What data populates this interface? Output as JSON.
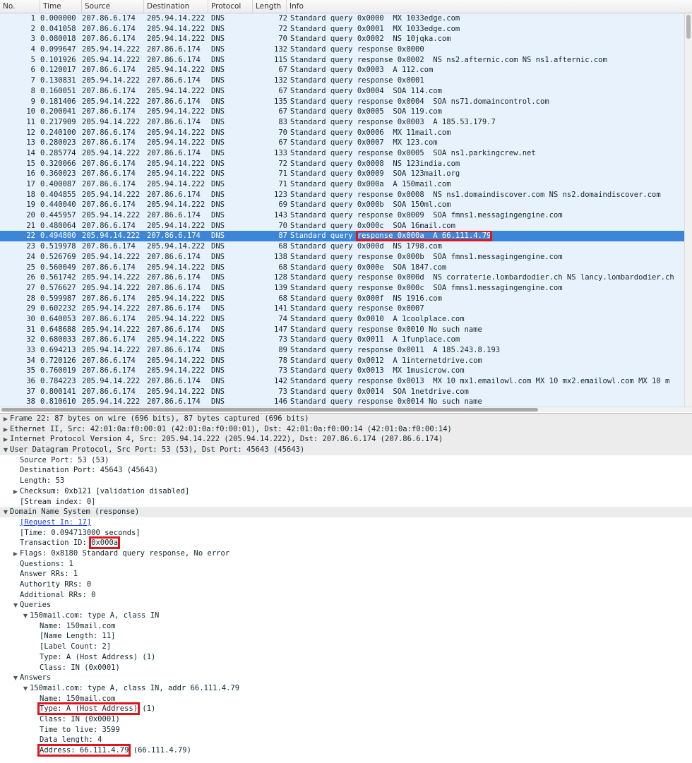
{
  "columns": [
    "No.",
    "Time",
    "Source",
    "Destination",
    "Protocol",
    "Length",
    "Info"
  ],
  "packets": [
    {
      "no": "1",
      "time": "0.000000",
      "src": "207.86.6.174",
      "dst": "205.94.14.222",
      "proto": "DNS",
      "len": "72",
      "info": "Standard query 0x0000  MX 1033edge.com"
    },
    {
      "no": "2",
      "time": "0.041058",
      "src": "207.86.6.174",
      "dst": "205.94.14.222",
      "proto": "DNS",
      "len": "72",
      "info": "Standard query 0x0001  MX 1033edge.com"
    },
    {
      "no": "3",
      "time": "0.080018",
      "src": "207.86.6.174",
      "dst": "205.94.14.222",
      "proto": "DNS",
      "len": "70",
      "info": "Standard query 0x0002  NS 10jqka.com"
    },
    {
      "no": "4",
      "time": "0.099647",
      "src": "205.94.14.222",
      "dst": "207.86.6.174",
      "proto": "DNS",
      "len": "132",
      "info": "Standard query response 0x0000"
    },
    {
      "no": "5",
      "time": "0.101926",
      "src": "205.94.14.222",
      "dst": "207.86.6.174",
      "proto": "DNS",
      "len": "115",
      "info": "Standard query response 0x0002  NS ns2.afternic.com NS ns1.afternic.com"
    },
    {
      "no": "6",
      "time": "0.120017",
      "src": "207.86.6.174",
      "dst": "205.94.14.222",
      "proto": "DNS",
      "len": "67",
      "info": "Standard query 0x0003  A 112.com"
    },
    {
      "no": "7",
      "time": "0.130831",
      "src": "205.94.14.222",
      "dst": "207.86.6.174",
      "proto": "DNS",
      "len": "132",
      "info": "Standard query response 0x0001"
    },
    {
      "no": "8",
      "time": "0.160051",
      "src": "207.86.6.174",
      "dst": "205.94.14.222",
      "proto": "DNS",
      "len": "67",
      "info": "Standard query 0x0004  SOA 114.com"
    },
    {
      "no": "9",
      "time": "0.181406",
      "src": "205.94.14.222",
      "dst": "207.86.6.174",
      "proto": "DNS",
      "len": "135",
      "info": "Standard query response 0x0004  SOA ns71.domaincontrol.com"
    },
    {
      "no": "10",
      "time": "0.200041",
      "src": "207.86.6.174",
      "dst": "205.94.14.222",
      "proto": "DNS",
      "len": "67",
      "info": "Standard query 0x0005  SOA 119.com"
    },
    {
      "no": "11",
      "time": "0.217909",
      "src": "205.94.14.222",
      "dst": "207.86.6.174",
      "proto": "DNS",
      "len": "83",
      "info": "Standard query response 0x0003  A 185.53.179.7"
    },
    {
      "no": "12",
      "time": "0.240100",
      "src": "207.86.6.174",
      "dst": "205.94.14.222",
      "proto": "DNS",
      "len": "70",
      "info": "Standard query 0x0006  MX 11mail.com"
    },
    {
      "no": "13",
      "time": "0.280023",
      "src": "207.86.6.174",
      "dst": "205.94.14.222",
      "proto": "DNS",
      "len": "67",
      "info": "Standard query 0x0007  MX 123.com"
    },
    {
      "no": "14",
      "time": "0.285774",
      "src": "205.94.14.222",
      "dst": "207.86.6.174",
      "proto": "DNS",
      "len": "133",
      "info": "Standard query response 0x0005  SOA ns1.parkingcrew.net"
    },
    {
      "no": "15",
      "time": "0.320066",
      "src": "207.86.6.174",
      "dst": "205.94.14.222",
      "proto": "DNS",
      "len": "72",
      "info": "Standard query 0x0008  NS 123india.com"
    },
    {
      "no": "16",
      "time": "0.360023",
      "src": "207.86.6.174",
      "dst": "205.94.14.222",
      "proto": "DNS",
      "len": "71",
      "info": "Standard query 0x0009  SOA 123mail.org"
    },
    {
      "no": "17",
      "time": "0.400087",
      "src": "207.86.6.174",
      "dst": "205.94.14.222",
      "proto": "DNS",
      "len": "71",
      "info": "Standard query 0x000a  A 150mail.com"
    },
    {
      "no": "18",
      "time": "0.404855",
      "src": "205.94.14.222",
      "dst": "207.86.6.174",
      "proto": "DNS",
      "len": "123",
      "info": "Standard query response 0x0008  NS ns1.domaindiscover.com NS ns2.domaindiscover.com"
    },
    {
      "no": "19",
      "time": "0.440040",
      "src": "207.86.6.174",
      "dst": "205.94.14.222",
      "proto": "DNS",
      "len": "69",
      "info": "Standard query 0x000b  SOA 150ml.com"
    },
    {
      "no": "20",
      "time": "0.445957",
      "src": "205.94.14.222",
      "dst": "207.86.6.174",
      "proto": "DNS",
      "len": "143",
      "info": "Standard query response 0x0009  SOA fmns1.messagingengine.com"
    },
    {
      "no": "21",
      "time": "0.480064",
      "src": "207.86.6.174",
      "dst": "205.94.14.222",
      "proto": "DNS",
      "len": "70",
      "info": "Standard query 0x000c  SOA 16mail.com"
    },
    {
      "no": "22",
      "time": "0.494800",
      "src": "205.94.14.222",
      "dst": "207.86.6.174",
      "proto": "DNS",
      "len": "87",
      "info_pre": "Standard query ",
      "info_hl": "response 0x000a  A 66.111.4.79",
      "selected": true
    },
    {
      "no": "23",
      "time": "0.519978",
      "src": "207.86.6.174",
      "dst": "205.94.14.222",
      "proto": "DNS",
      "len": "68",
      "info": "Standard query 0x000d  NS 1798.com"
    },
    {
      "no": "24",
      "time": "0.526769",
      "src": "205.94.14.222",
      "dst": "207.86.6.174",
      "proto": "DNS",
      "len": "138",
      "info": "Standard query response 0x000b  SOA fmns1.messagingengine.com"
    },
    {
      "no": "25",
      "time": "0.560049",
      "src": "207.86.6.174",
      "dst": "205.94.14.222",
      "proto": "DNS",
      "len": "68",
      "info": "Standard query 0x000e  SOA 1847.com"
    },
    {
      "no": "26",
      "time": "0.561742",
      "src": "205.94.14.222",
      "dst": "207.86.6.174",
      "proto": "DNS",
      "len": "128",
      "info": "Standard query response 0x000d  NS corraterie.lombardodier.ch NS lancy.lombardodier.ch"
    },
    {
      "no": "27",
      "time": "0.576627",
      "src": "205.94.14.222",
      "dst": "207.86.6.174",
      "proto": "DNS",
      "len": "139",
      "info": "Standard query response 0x000c  SOA fmns1.messagingengine.com"
    },
    {
      "no": "28",
      "time": "0.599987",
      "src": "207.86.6.174",
      "dst": "205.94.14.222",
      "proto": "DNS",
      "len": "68",
      "info": "Standard query 0x000f  NS 1916.com"
    },
    {
      "no": "29",
      "time": "0.602232",
      "src": "205.94.14.222",
      "dst": "207.86.6.174",
      "proto": "DNS",
      "len": "141",
      "info": "Standard query response 0x0007"
    },
    {
      "no": "30",
      "time": "0.640053",
      "src": "207.86.6.174",
      "dst": "205.94.14.222",
      "proto": "DNS",
      "len": "74",
      "info": "Standard query 0x0010  A 1coolplace.com"
    },
    {
      "no": "31",
      "time": "0.648688",
      "src": "205.94.14.222",
      "dst": "207.86.6.174",
      "proto": "DNS",
      "len": "147",
      "info": "Standard query response 0x0010 No such name"
    },
    {
      "no": "32",
      "time": "0.680033",
      "src": "207.86.6.174",
      "dst": "205.94.14.222",
      "proto": "DNS",
      "len": "73",
      "info": "Standard query 0x0011  A 1funplace.com"
    },
    {
      "no": "33",
      "time": "0.694213",
      "src": "205.94.14.222",
      "dst": "207.86.6.174",
      "proto": "DNS",
      "len": "89",
      "info": "Standard query response 0x0011  A 185.243.8.193"
    },
    {
      "no": "34",
      "time": "0.720126",
      "src": "207.86.6.174",
      "dst": "205.94.14.222",
      "proto": "DNS",
      "len": "78",
      "info": "Standard query 0x0012  A 1internetdrive.com"
    },
    {
      "no": "35",
      "time": "0.760019",
      "src": "207.86.6.174",
      "dst": "205.94.14.222",
      "proto": "DNS",
      "len": "73",
      "info": "Standard query 0x0013  MX 1musicrow.com"
    },
    {
      "no": "36",
      "time": "0.784223",
      "src": "205.94.14.222",
      "dst": "207.86.6.174",
      "proto": "DNS",
      "len": "142",
      "info": "Standard query response 0x0013  MX 10 mx1.emailowl.com MX 10 mx2.emailowl.com MX 10 m"
    },
    {
      "no": "37",
      "time": "0.800141",
      "src": "207.86.6.174",
      "dst": "205.94.14.222",
      "proto": "DNS",
      "len": "73",
      "info": "Standard query 0x0014  SOA 1netdrive.com"
    },
    {
      "no": "38",
      "time": "0.810610",
      "src": "205.94.14.222",
      "dst": "207.86.6.174",
      "proto": "DNS",
      "len": "146",
      "info": "Standard query response 0x0014 No such name"
    }
  ],
  "details": [
    {
      "indent": 0,
      "arrow": "right",
      "section": true,
      "text": "Frame 22: 87 bytes on wire (696 bits), 87 bytes captured (696 bits)"
    },
    {
      "indent": 0,
      "arrow": "right",
      "section": true,
      "text": "Ethernet II, Src: 42:01:0a:f0:00:01 (42:01:0a:f0:00:01), Dst: 42:01:0a:f0:00:14 (42:01:0a:f0:00:14)"
    },
    {
      "indent": 0,
      "arrow": "right",
      "section": true,
      "text": "Internet Protocol Version 4, Src: 205.94.14.222 (205.94.14.222), Dst: 207.86.6.174 (207.86.6.174)"
    },
    {
      "indent": 0,
      "arrow": "down",
      "section": true,
      "text": "User Datagram Protocol, Src Port: 53 (53), Dst Port: 45643 (45643)"
    },
    {
      "indent": 1,
      "text": "Source Port: 53 (53)"
    },
    {
      "indent": 1,
      "text": "Destination Port: 45643 (45643)"
    },
    {
      "indent": 1,
      "text": "Length: 53"
    },
    {
      "indent": 1,
      "arrow": "right",
      "text": "Checksum: 0xb121 [validation disabled]"
    },
    {
      "indent": 1,
      "text": "[Stream index: 0]"
    },
    {
      "indent": 0,
      "arrow": "down",
      "section": true,
      "text": "Domain Name System (response)"
    },
    {
      "indent": 1,
      "link": true,
      "text": "[Request In: 17]"
    },
    {
      "indent": 1,
      "text": "[Time: 0.094713000 seconds]"
    },
    {
      "indent": 1,
      "text": "Transaction ID: ",
      "boxed": "0x000a",
      "after": ""
    },
    {
      "indent": 1,
      "arrow": "right",
      "text": "Flags: 0x8180 Standard query response, No error"
    },
    {
      "indent": 1,
      "text": "Questions: 1"
    },
    {
      "indent": 1,
      "text": "Answer RRs: 1"
    },
    {
      "indent": 1,
      "text": "Authority RRs: 0"
    },
    {
      "indent": 1,
      "text": "Additional RRs: 0"
    },
    {
      "indent": 1,
      "arrow": "down",
      "text": "Queries"
    },
    {
      "indent": 2,
      "arrow": "down",
      "text": "150mail.com: type A, class IN"
    },
    {
      "indent": 3,
      "text": "Name: 150mail.com"
    },
    {
      "indent": 3,
      "text": "[Name Length: 11]"
    },
    {
      "indent": 3,
      "text": "[Label Count: 2]"
    },
    {
      "indent": 3,
      "text": "Type: A (Host Address) (1)"
    },
    {
      "indent": 3,
      "text": "Class: IN (0x0001)"
    },
    {
      "indent": 1,
      "arrow": "down",
      "text": "Answers"
    },
    {
      "indent": 2,
      "arrow": "down",
      "text": "150mail.com: type A, class IN, addr 66.111.4.79"
    },
    {
      "indent": 3,
      "text": "Name: 150mail.com"
    },
    {
      "indent": 3,
      "text": "",
      "boxed": "Type: A (Host Address)",
      "after": " (1)"
    },
    {
      "indent": 3,
      "text": "Class: IN (0x0001)"
    },
    {
      "indent": 3,
      "text": "Time to live: 3599"
    },
    {
      "indent": 3,
      "text": "Data length: 4"
    },
    {
      "indent": 3,
      "text": "",
      "boxed": "Address: 66.111.4.79",
      "after": " (66.111.4.79)"
    }
  ]
}
